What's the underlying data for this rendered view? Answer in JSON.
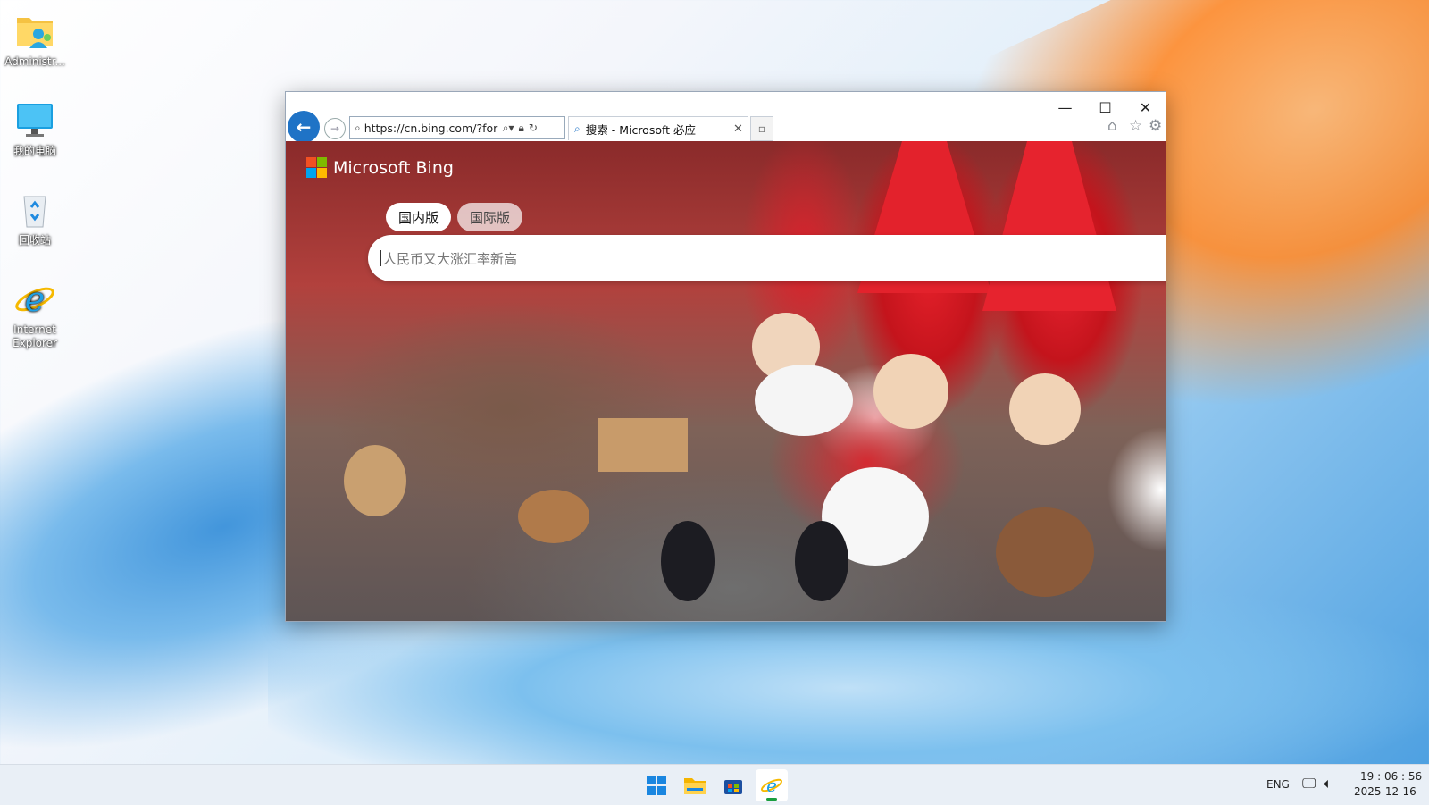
{
  "desktop": {
    "icons": [
      {
        "label": "Administr..."
      },
      {
        "label": "我的电脑"
      },
      {
        "label": "回收站"
      },
      {
        "label": "Internet Explorer"
      }
    ]
  },
  "browser": {
    "address_url": "https://cn.bing.com/?forr",
    "tab_title": "搜索 - Microsoft 必应",
    "window_controls": {
      "minimize": "—",
      "maximize": "☐",
      "close": "✕"
    },
    "toolbar_icons": [
      "home-icon",
      "favorites-star-icon",
      "settings-gear-icon"
    ]
  },
  "page": {
    "logo_text": "Microsoft Bing",
    "scope_tabs": [
      {
        "label": "国内版",
        "selected": true
      },
      {
        "label": "国际版",
        "selected": false
      }
    ],
    "search_placeholder": "人民币又大涨汇率新高"
  },
  "taskbar": {
    "apps": [
      "windows-start-icon",
      "file-explorer-icon",
      "microsoft-store-icon",
      "internet-explorer-icon"
    ],
    "language": "ENG",
    "time": "19 : 06 : 56",
    "date": "2025-12-16"
  },
  "colors": {
    "ie_blue": "#1f73c6",
    "ms_red": "#f25022",
    "ms_green": "#7fba00",
    "ms_blue": "#00a4ef",
    "ms_yellow": "#ffb900"
  }
}
